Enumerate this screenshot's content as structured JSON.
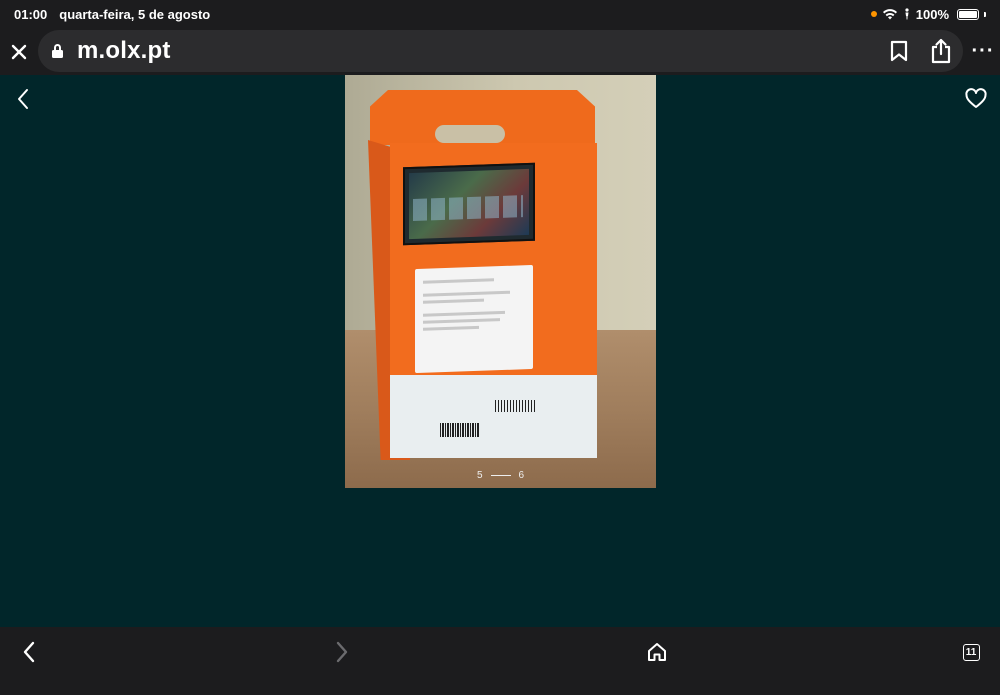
{
  "status_bar": {
    "time": "01:00",
    "date": "quarta-feira, 5 de agosto",
    "battery_text": "100%",
    "recording_dot_color": "#ff9500"
  },
  "url_bar": {
    "url": "m.olx.pt",
    "close_icon": "close-icon",
    "lock_icon": "lock-icon",
    "bookmark_icon": "bookmark-icon",
    "share_icon": "share-icon",
    "more_label": "···"
  },
  "gallery": {
    "back_icon": "chevron-left-icon",
    "favorite_icon": "heart-outline-icon",
    "current_index": "5",
    "total": "6",
    "background_color": "#01262a"
  },
  "toolbar": {
    "back_icon": "chevron-left-icon",
    "forward_icon": "chevron-right-icon",
    "home_icon": "home-icon",
    "tabs_count": "11"
  }
}
